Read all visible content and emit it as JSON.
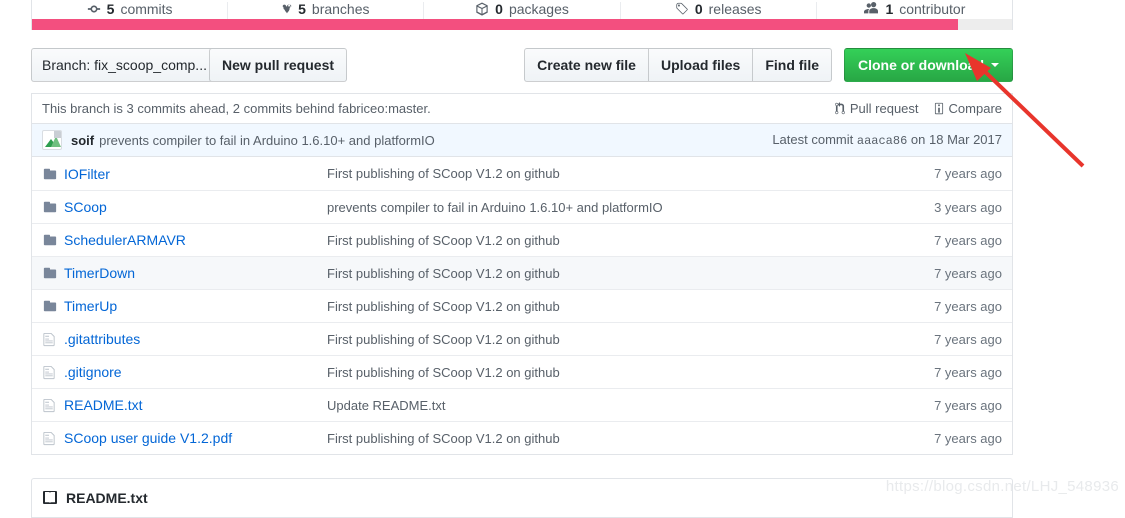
{
  "repo_stats": [
    {
      "icon": "commit-icon",
      "count": "5",
      "label": "commits"
    },
    {
      "icon": "branch-icon",
      "count": "5",
      "label": "branches"
    },
    {
      "icon": "package-icon",
      "count": "0",
      "label": "packages"
    },
    {
      "icon": "tag-icon",
      "count": "0",
      "label": "releases"
    },
    {
      "icon": "people-icon",
      "count": "1",
      "label": "contributor"
    }
  ],
  "language_bar": [
    {
      "name": "primary-language",
      "color": "#f34f7f",
      "percent": 94.5
    }
  ],
  "toolbar": {
    "branch_label": "Branch: fix_scoop_comp...",
    "new_pull_request": "New pull request",
    "create_new_file": "Create new file",
    "upload_files": "Upload files",
    "find_file": "Find file",
    "clone_or_download": "Clone or download"
  },
  "branch_status": {
    "text": "This branch is 3 commits ahead, 2 commits behind fabriceo:master.",
    "pull_request": "Pull request",
    "compare": "Compare"
  },
  "latest_commit": {
    "author": "soif",
    "message": "prevents compiler to fail in Arduino 1.6.10+ and platformIO",
    "prefix": "Latest commit",
    "sha": "aaaca86",
    "date": "on 18 Mar 2017"
  },
  "files": [
    {
      "type": "folder",
      "name": "IOFilter",
      "message": "First publishing of SCoop V1.2 on github",
      "age": "7 years ago",
      "hover": false
    },
    {
      "type": "folder",
      "name": "SCoop",
      "message": "prevents compiler to fail in Arduino 1.6.10+ and platformIO",
      "age": "3 years ago",
      "hover": false
    },
    {
      "type": "folder",
      "name": "SchedulerARMAVR",
      "message": "First publishing of SCoop V1.2 on github",
      "age": "7 years ago",
      "hover": false
    },
    {
      "type": "folder",
      "name": "TimerDown",
      "message": "First publishing of SCoop V1.2 on github",
      "age": "7 years ago",
      "hover": true
    },
    {
      "type": "folder",
      "name": "TimerUp",
      "message": "First publishing of SCoop V1.2 on github",
      "age": "7 years ago",
      "hover": false
    },
    {
      "type": "file",
      "name": ".gitattributes",
      "message": "First publishing of SCoop V1.2 on github",
      "age": "7 years ago",
      "hover": false
    },
    {
      "type": "file",
      "name": ".gitignore",
      "message": "First publishing of SCoop V1.2 on github",
      "age": "7 years ago",
      "hover": false
    },
    {
      "type": "file",
      "name": "README.txt",
      "message": "Update README.txt",
      "age": "7 years ago",
      "hover": false
    },
    {
      "type": "file",
      "name": "SCoop user guide V1.2.pdf",
      "message": "First publishing of SCoop V1.2 on github",
      "age": "7 years ago",
      "hover": false
    }
  ],
  "readme": {
    "title": "README.txt"
  },
  "watermark": {
    "text": "https://blog.csdn.net/LHJ_548936"
  },
  "colors": {
    "link": "#0366d6",
    "green_button": "#28a745",
    "language_pink": "#f34f7f",
    "annotation_red": "#e8352c",
    "commit_bar_bg": "#f1f8ff"
  }
}
